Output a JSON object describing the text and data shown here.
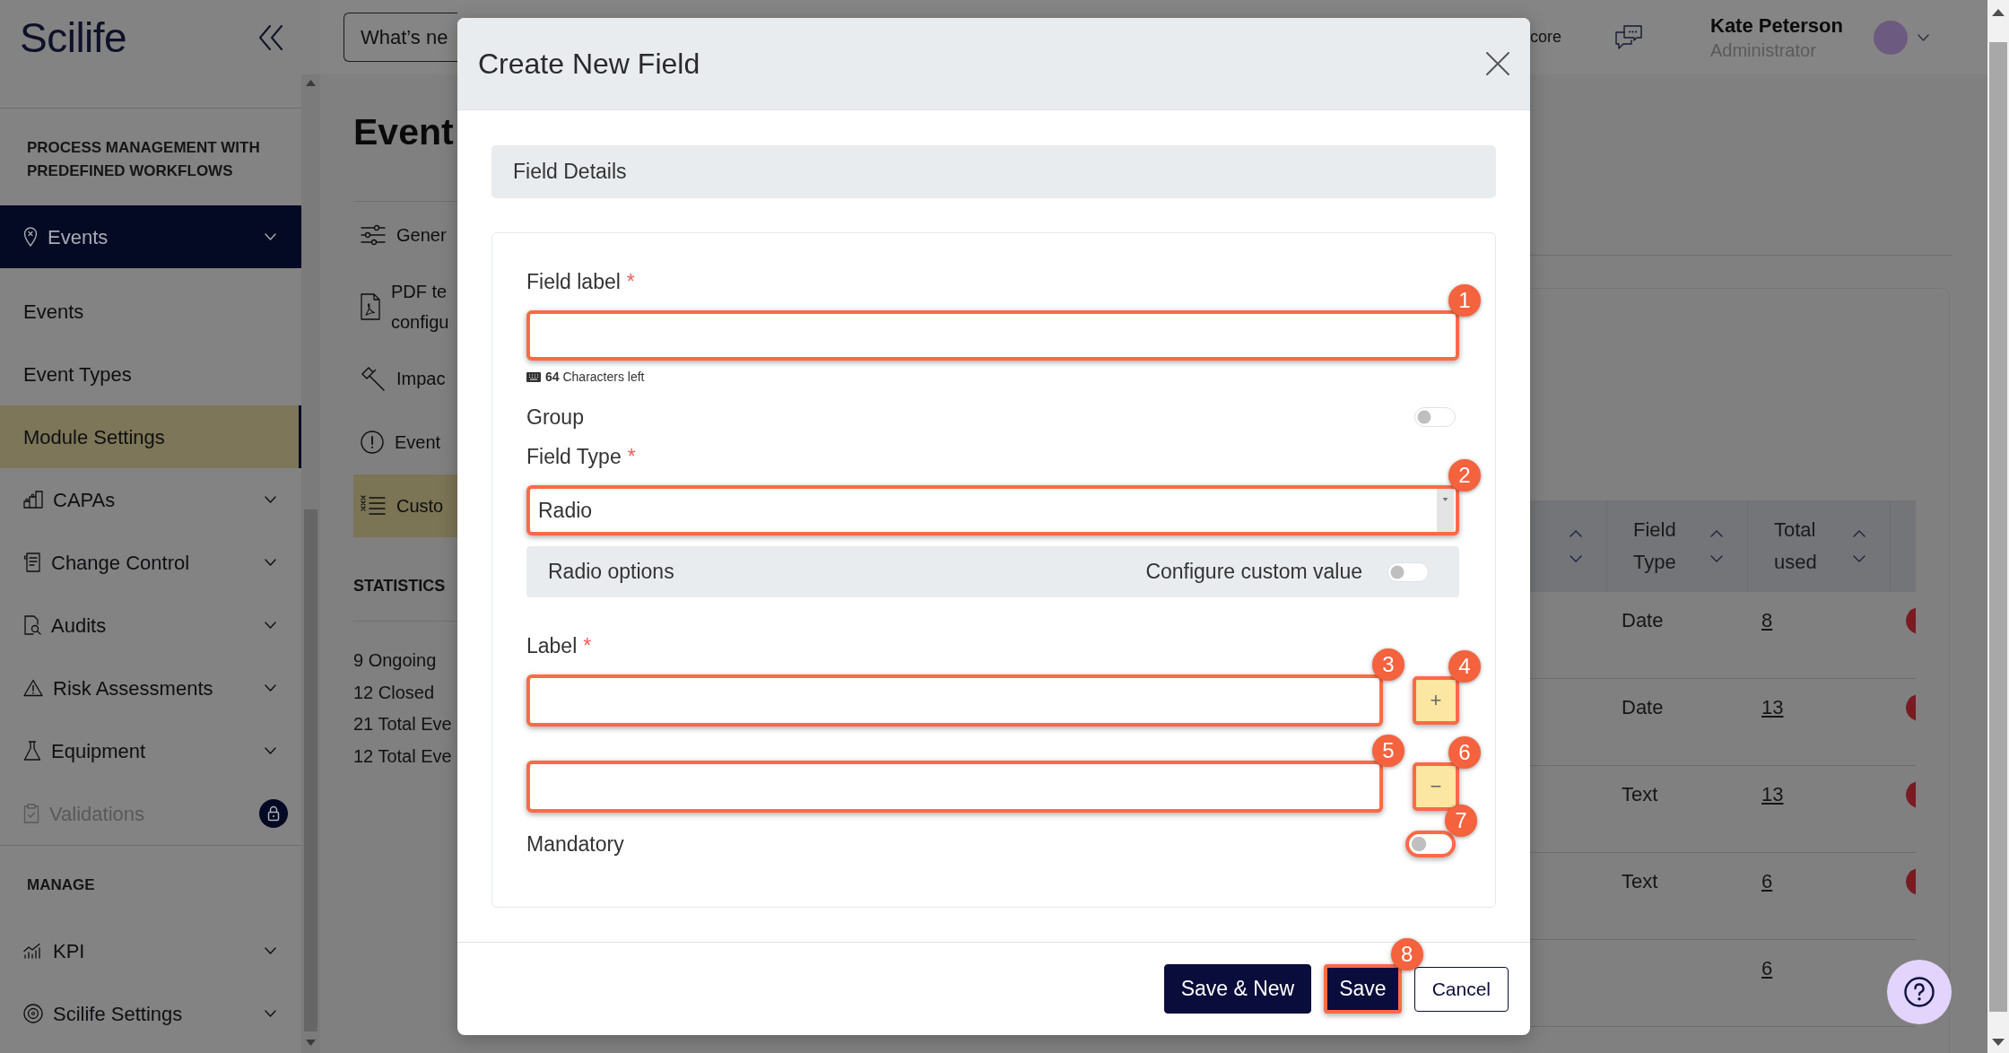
{
  "sidebar": {
    "logo": "Scilife",
    "sections": [
      {
        "title": "PROCESS MANAGEMENT WITH PREDEFINED WORKFLOWS",
        "items": [
          {
            "label": "Events",
            "expanded": true,
            "disabled": false,
            "children": [
              {
                "label": "Events",
                "selected": false
              },
              {
                "label": "Event Types",
                "selected": false
              },
              {
                "label": "Module Settings",
                "selected": true
              }
            ]
          },
          {
            "label": "CAPAs",
            "expanded": false,
            "disabled": false
          },
          {
            "label": "Change Control",
            "expanded": false,
            "disabled": false
          },
          {
            "label": "Audits",
            "expanded": false,
            "disabled": false
          },
          {
            "label": "Risk Assessments",
            "expanded": false,
            "disabled": false
          },
          {
            "label": "Equipment",
            "expanded": false,
            "disabled": false
          },
          {
            "label": "Validations",
            "expanded": false,
            "disabled": true
          }
        ]
      },
      {
        "title": "MANAGE",
        "items": [
          {
            "label": "KPI",
            "expanded": false,
            "disabled": false
          },
          {
            "label": "Scilife Settings",
            "expanded": false,
            "disabled": false
          }
        ]
      }
    ]
  },
  "top_bar": {
    "whats_new_button": "What’s ne",
    "header_text": "core",
    "user": {
      "name": "Kate Peterson",
      "role": "Administrator"
    }
  },
  "page": {
    "title": "Event",
    "settings_nav": [
      {
        "lines": [
          "Gener"
        ],
        "selected": false
      },
      {
        "lines": [
          "PDF te",
          "configu"
        ],
        "selected": false
      },
      {
        "lines": [
          "Impac"
        ],
        "selected": false
      },
      {
        "lines": [
          "Event"
        ],
        "selected": false
      },
      {
        "lines": [
          "Custo"
        ],
        "selected": true
      }
    ],
    "statistics": {
      "title": "STATISTICS",
      "lines": [
        "9 Ongoing",
        "12 Closed",
        "21 Total Eve",
        "12 Total Eve"
      ]
    }
  },
  "table": {
    "columns": [
      {
        "label": "Field Type"
      },
      {
        "label": "Total used"
      }
    ],
    "rows": [
      {
        "field_type": "Date",
        "total_used": "8"
      },
      {
        "field_type": "Date",
        "total_used": "13"
      },
      {
        "field_type": "Text",
        "total_used": "13"
      },
      {
        "field_type": "Text",
        "total_used": "6"
      },
      {
        "total_used": "6"
      }
    ]
  },
  "modal": {
    "title": "Create New Field",
    "section_title": "Field Details",
    "fields": [
      {
        "kind": "text",
        "label": "Field label",
        "required_mark": "*",
        "callout": "1",
        "counter": "**64** Characters left"
      },
      {
        "kind": "switch",
        "label": "Group",
        "on": false
      },
      {
        "kind": "select",
        "label": "Field Type",
        "required_mark": "*",
        "value": "Radio",
        "callout": "2"
      },
      {
        "kind": "options_header",
        "label": "Radio options",
        "switch_label": "Configure custom value",
        "on": false
      },
      {
        "kind": "option_list",
        "label": "Label",
        "required_mark": "*",
        "rows": [
          {
            "callout": "3",
            "button": {
              "label": "+",
              "callout": "4"
            }
          },
          {
            "callout": "5",
            "button": {
              "label": "−",
              "callout": "6"
            }
          }
        ]
      },
      {
        "kind": "switch",
        "label": "Mandatory",
        "on": false,
        "callout": "7"
      }
    ],
    "buttons": [
      {
        "kind": "primary",
        "label": "Save & New"
      },
      {
        "kind": "primary",
        "label": "Save",
        "callout": "8"
      },
      {
        "kind": "secondary",
        "label": "Cancel"
      }
    ]
  }
}
